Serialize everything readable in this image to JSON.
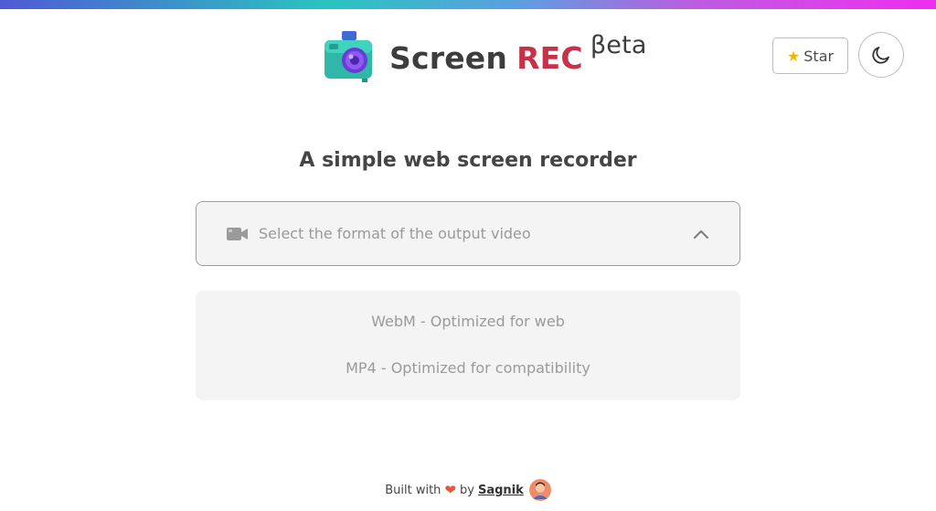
{
  "header": {
    "brand_primary": "Screen",
    "brand_accent": "REC",
    "brand_badge": "βeta",
    "logo_icon": "camera-icon",
    "star_label": "Star",
    "star_icon": "star-icon",
    "theme_icon": "moon-icon"
  },
  "main": {
    "subtitle": "A simple web screen recorder",
    "format_select": {
      "icon": "video-camera-icon",
      "placeholder": "Select the format of the output video",
      "state": "expanded"
    },
    "options": [
      {
        "label": "WebM - Optimized for web"
      },
      {
        "label": "MP4 - Optimized for compatibility"
      }
    ]
  },
  "footer": {
    "prefix": "Built with",
    "middle": "by",
    "author": "Sagnik"
  },
  "colors": {
    "accent_red": "#c8314a",
    "heart": "#e8553a",
    "star": "#f4b400",
    "text_dark": "#3d3d3d",
    "muted": "#9a9a9a"
  }
}
